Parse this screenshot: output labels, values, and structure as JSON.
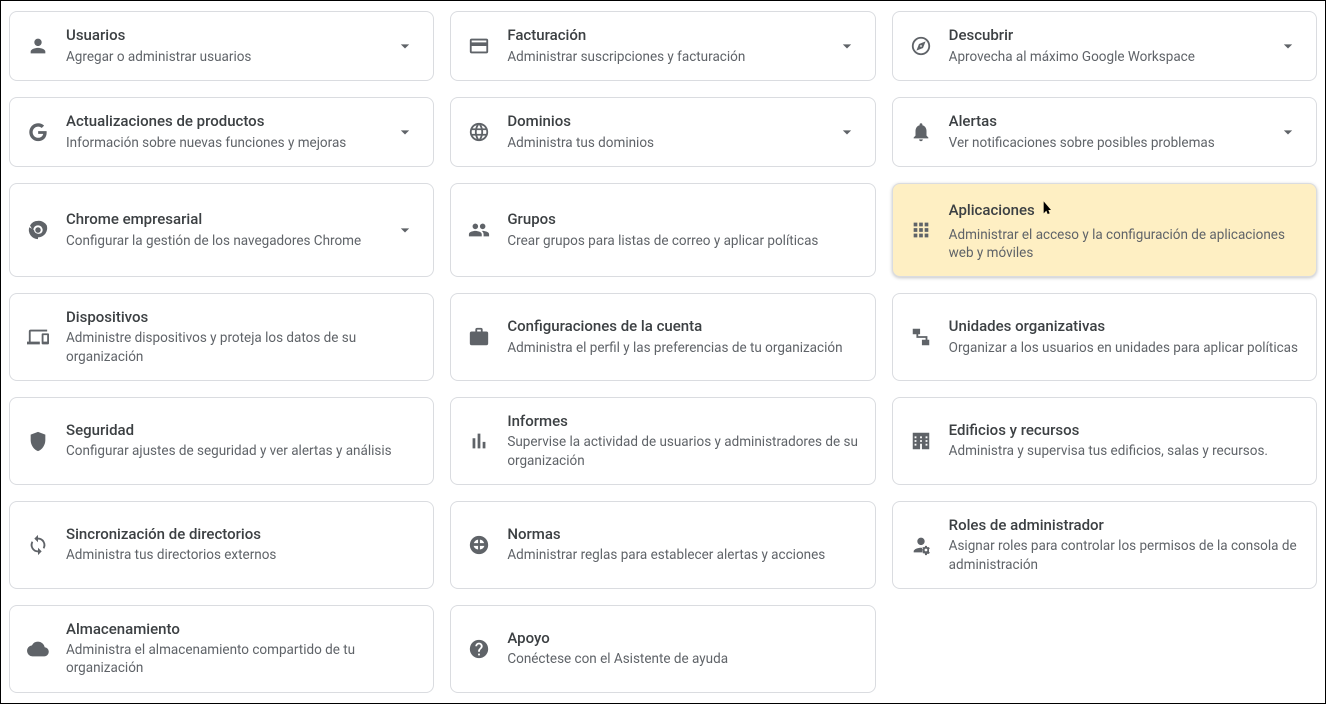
{
  "cards": [
    {
      "id": "users",
      "icon": "user",
      "title": "Usuarios",
      "desc": "Agregar o administrar usuarios",
      "expandable": true
    },
    {
      "id": "billing",
      "icon": "card",
      "title": "Facturación",
      "desc": "Administrar suscripciones y facturación",
      "expandable": true
    },
    {
      "id": "discover",
      "icon": "compass",
      "title": "Descubrir",
      "desc": "Aprovecha al máximo Google Workspace",
      "expandable": true
    },
    {
      "id": "product-updates",
      "icon": "google",
      "title": "Actualizaciones de productos",
      "desc": "Información sobre nuevas funciones y mejoras",
      "expandable": true
    },
    {
      "id": "domains",
      "icon": "globe",
      "title": "Dominios",
      "desc": "Administra tus dominios",
      "expandable": true
    },
    {
      "id": "alerts",
      "icon": "bell",
      "title": "Alertas",
      "desc": "Ver notificaciones sobre posibles problemas",
      "expandable": true
    },
    {
      "id": "chrome",
      "icon": "chrome",
      "title": "Chrome empresarial",
      "desc": "Configurar la gestión de los navegadores Chrome",
      "expandable": true
    },
    {
      "id": "groups",
      "icon": "groups",
      "title": "Grupos",
      "desc": "Crear grupos para listas de correo y aplicar políticas",
      "expandable": false
    },
    {
      "id": "apps",
      "icon": "apps",
      "title": "Aplicaciones",
      "desc": "Administrar el acceso y la configuración de aplicaciones web y móviles",
      "expandable": false,
      "highlight": true,
      "cursor": true
    },
    {
      "id": "devices",
      "icon": "devices",
      "title": "Dispositivos",
      "desc": "Administre dispositivos y proteja los datos de su organización",
      "expandable": false
    },
    {
      "id": "account-settings",
      "icon": "briefcase",
      "title": "Configuraciones de la cuenta",
      "desc": "Administra el perfil y las preferencias de tu organización",
      "expandable": false
    },
    {
      "id": "org-units",
      "icon": "orgunits",
      "title": "Unidades organizativas",
      "desc": "Organizar a los usuarios en unidades para aplicar políticas",
      "expandable": false
    },
    {
      "id": "security",
      "icon": "shield",
      "title": "Seguridad",
      "desc": "Configurar ajustes de seguridad y ver alertas y análisis",
      "expandable": false
    },
    {
      "id": "reports",
      "icon": "bars",
      "title": "Informes",
      "desc": "Supervise la actividad de usuarios y administradores de su organización",
      "expandable": false
    },
    {
      "id": "buildings",
      "icon": "building",
      "title": "Edificios y recursos",
      "desc": "Administra y supervisa tus edificios, salas y recursos.",
      "expandable": false
    },
    {
      "id": "directory-sync",
      "icon": "sync",
      "title": "Sincronización de directorios",
      "desc": "Administra tus directorios externos",
      "expandable": false
    },
    {
      "id": "rules",
      "icon": "wheel",
      "title": "Normas",
      "desc": "Administrar reglas para establecer alertas y acciones",
      "expandable": false
    },
    {
      "id": "admin-roles",
      "icon": "admin",
      "title": "Roles de administrador",
      "desc": "Asignar roles para controlar los permisos de la consola de administración",
      "expandable": false
    },
    {
      "id": "storage",
      "icon": "cloud",
      "title": "Almacenamiento",
      "desc": "Administra el almacenamiento compartido de tu organización",
      "expandable": false
    },
    {
      "id": "support",
      "icon": "help",
      "title": "Apoyo",
      "desc": "Conéctese con el Asistente de ayuda",
      "expandable": false
    }
  ]
}
